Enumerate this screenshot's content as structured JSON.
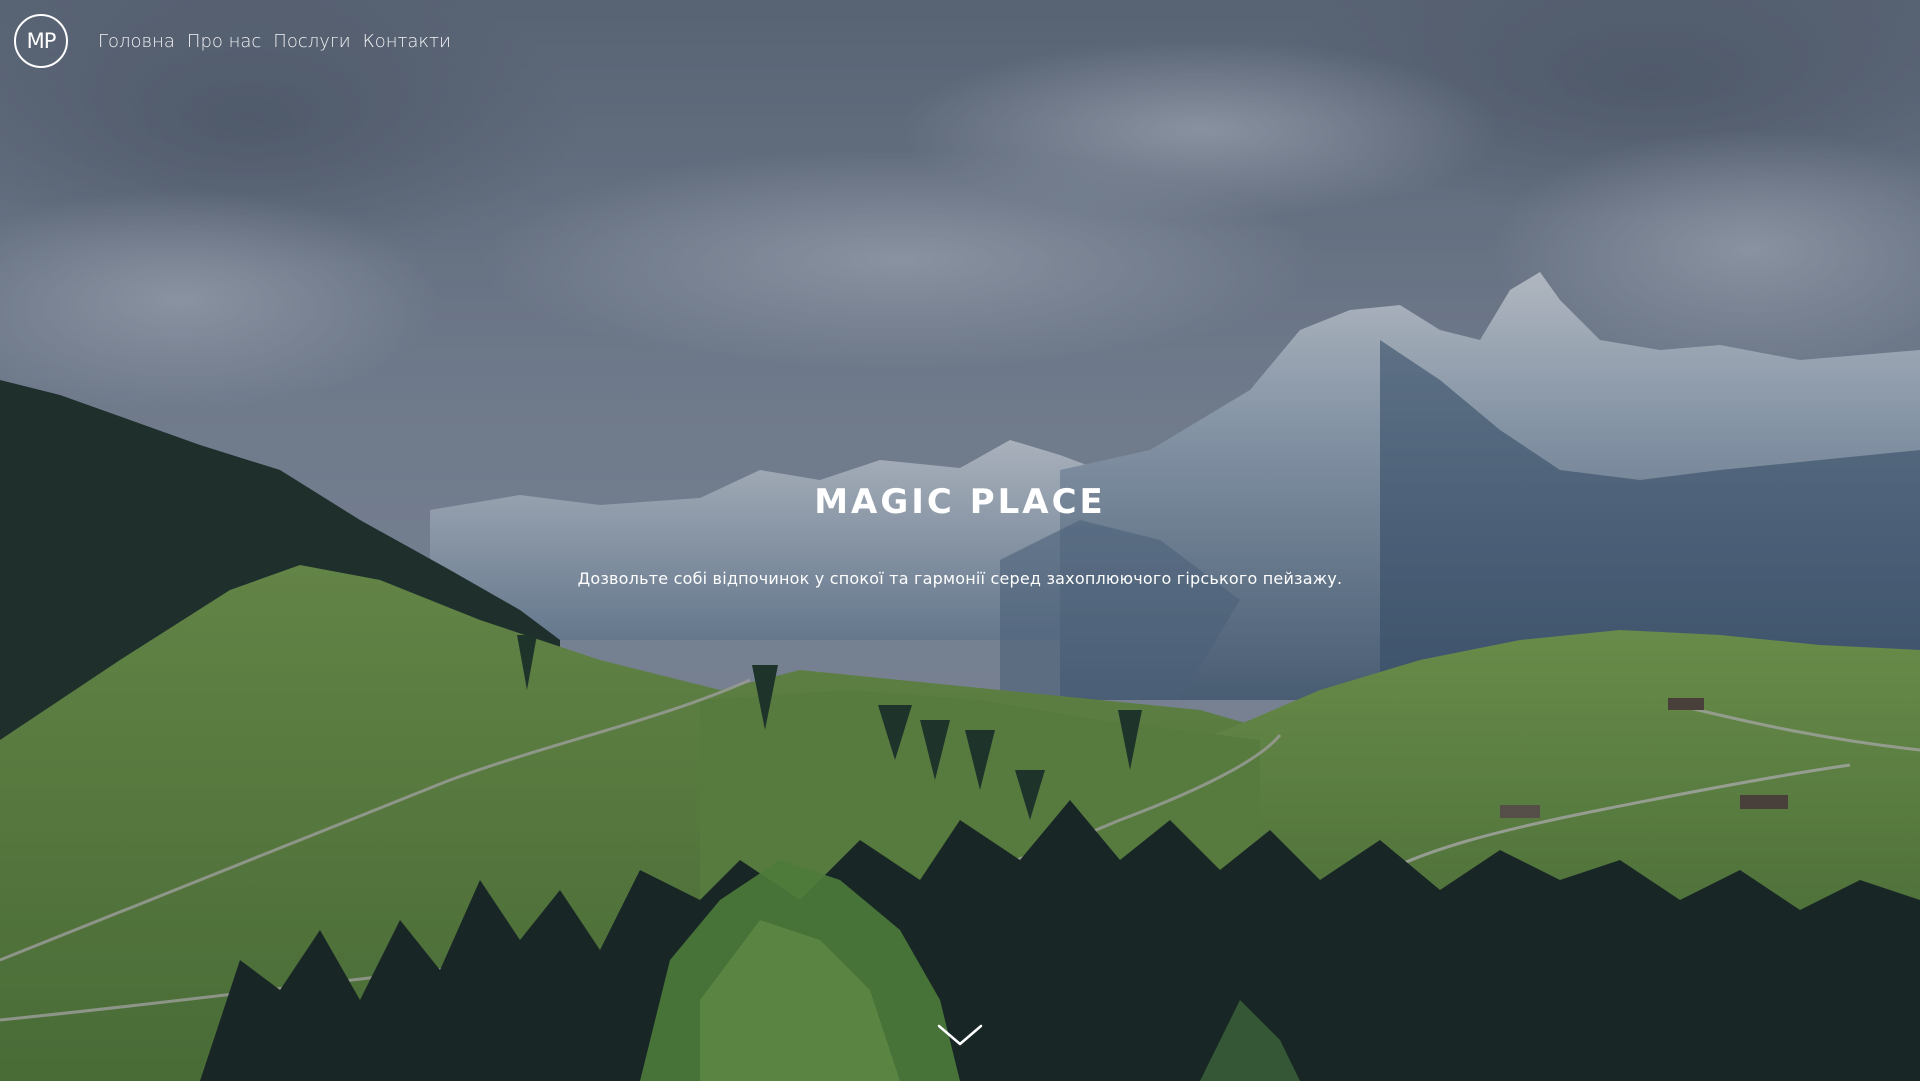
{
  "brand": {
    "logo_text": "MP"
  },
  "nav": {
    "items": [
      {
        "label": "Головна"
      },
      {
        "label": "Про нас"
      },
      {
        "label": "Послуги"
      },
      {
        "label": "Контакти"
      }
    ]
  },
  "hero": {
    "title": "MAGIC PLACE",
    "subtitle": "Дозвольте собі відпочинок у спокої та гармонії серед захоплюючого гірського пейзажу.",
    "background": "mountain-valley-photo",
    "scroll_icon": "chevron-down-icon"
  },
  "colors": {
    "text": "#ffffff",
    "overlay": "#1e283c",
    "sky": "#8d98a8",
    "meadow": "#6f9a40",
    "forest": "#1d3324"
  }
}
